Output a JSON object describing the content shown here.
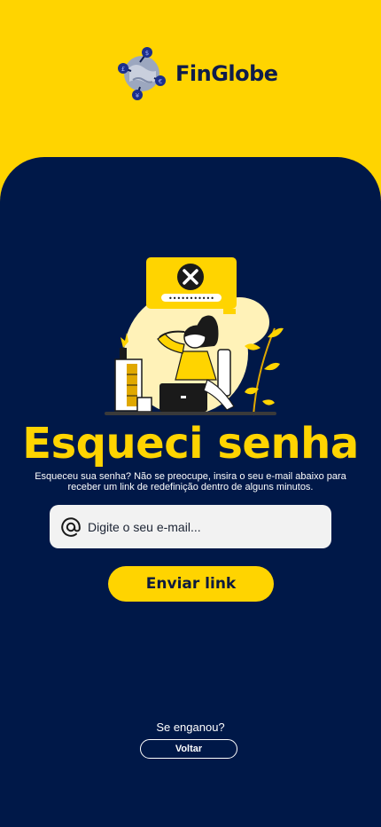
{
  "brand": {
    "name": "FinGlobe",
    "accent": "#FFD400",
    "background": "#001848"
  },
  "page": {
    "title": "Esqueci senha",
    "subtitle": "Esqueceu sua senha? Não se preocupe, insira o seu e-mail abaixo para receber um link de redefinição dentro de alguns minutos."
  },
  "illustration": {
    "masked_password": "•••••••••••",
    "icon": "error-x-icon"
  },
  "form": {
    "email_placeholder": "Digite o seu e-mail...",
    "email_icon": "at-icon",
    "submit_label": "Enviar link"
  },
  "footer": {
    "question": "Se enganou?",
    "back_label": "Voltar"
  }
}
